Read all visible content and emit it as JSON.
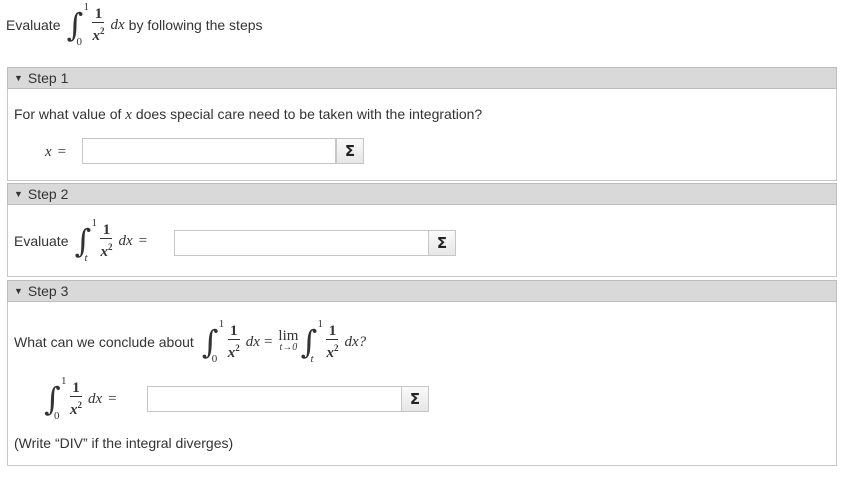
{
  "intro": {
    "prefix": "Evaluate",
    "integral": {
      "upper": "1",
      "lower": "0",
      "numerator": "1",
      "denominator_var": "x",
      "denominator_exp": "2",
      "differential": "dx"
    },
    "suffix": "by following the steps"
  },
  "steps": [
    {
      "title": "Step 1",
      "question": "For what value of",
      "question_var": "x",
      "question_rest": "does special care need to be taken with the integration?",
      "answer_label_var": "x",
      "answer_label_eq": "=",
      "answer_value": "",
      "sigma": "Σ"
    },
    {
      "title": "Step 2",
      "prompt": "Evaluate",
      "integral": {
        "upper": "1",
        "lower": "t",
        "numerator": "1",
        "denominator_var": "x",
        "denominator_exp": "2",
        "differential": "dx"
      },
      "eq": "=",
      "answer_value": "",
      "sigma": "Σ"
    },
    {
      "title": "Step 3",
      "question": "What can we conclude about",
      "integral_a": {
        "upper": "1",
        "lower": "0",
        "numerator": "1",
        "denominator_var": "x",
        "denominator_exp": "2",
        "differential": "dx"
      },
      "eq": "=",
      "lim_word": "lim",
      "lim_sub": "t→0",
      "integral_b": {
        "upper": "1",
        "lower": "t",
        "numerator": "1",
        "denominator_var": "x",
        "denominator_exp": "2",
        "differential": "dx?"
      },
      "answer_integral": {
        "upper": "1",
        "lower": "0",
        "numerator": "1",
        "denominator_var": "x",
        "denominator_exp": "2",
        "differential": "dx"
      },
      "answer_eq": "=",
      "answer_value": "",
      "sigma": "Σ",
      "note": "(Write “DIV” if the integral diverges)"
    }
  ]
}
